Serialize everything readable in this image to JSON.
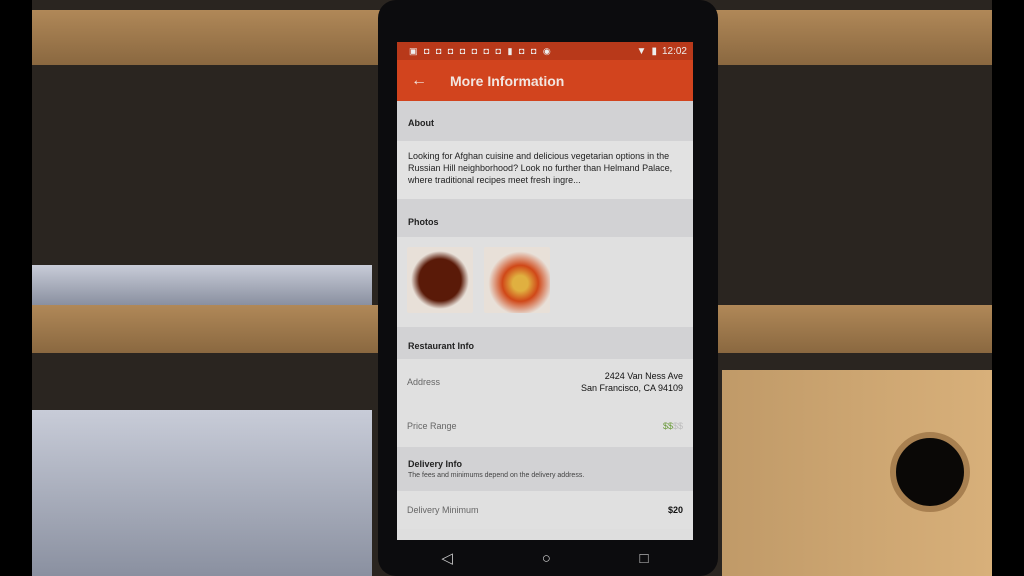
{
  "status_bar": {
    "time": "12:02",
    "icons": [
      "notification-icon",
      "wifi-icon",
      "no-sim-icon",
      "battery-icon"
    ]
  },
  "app_bar": {
    "title": "More Information",
    "back_icon": "arrow-left-icon"
  },
  "about": {
    "header": "About",
    "text": "Looking for Afghan cuisine and delicious vegetarian options in the Russian Hill neighborhood? Look no further than Helmand Palace, where traditional recipes meet fresh ingre..."
  },
  "photos": {
    "header": "Photos",
    "items": [
      "soup-photo",
      "stew-photo"
    ]
  },
  "restaurant_info": {
    "header": "Restaurant Info",
    "address_label": "Address",
    "address_line1": "2424 Van Ness Ave",
    "address_line2": "San Francisco, CA 94109",
    "price_label": "Price Range",
    "price_active": "$$",
    "price_inactive": "$$",
    "price_level": 2,
    "price_max": 4
  },
  "delivery_info": {
    "header": "Delivery Info",
    "subtitle": "The fees and minimums depend on the delivery address.",
    "minimum_label": "Delivery Minimum",
    "minimum_value": "$20"
  },
  "nav": {
    "back": "◁",
    "home": "○",
    "recents": "□"
  },
  "colors": {
    "app_bar": "#d2441e",
    "price_active": "#6a9a3a",
    "price_inactive": "#bbbbbb"
  }
}
